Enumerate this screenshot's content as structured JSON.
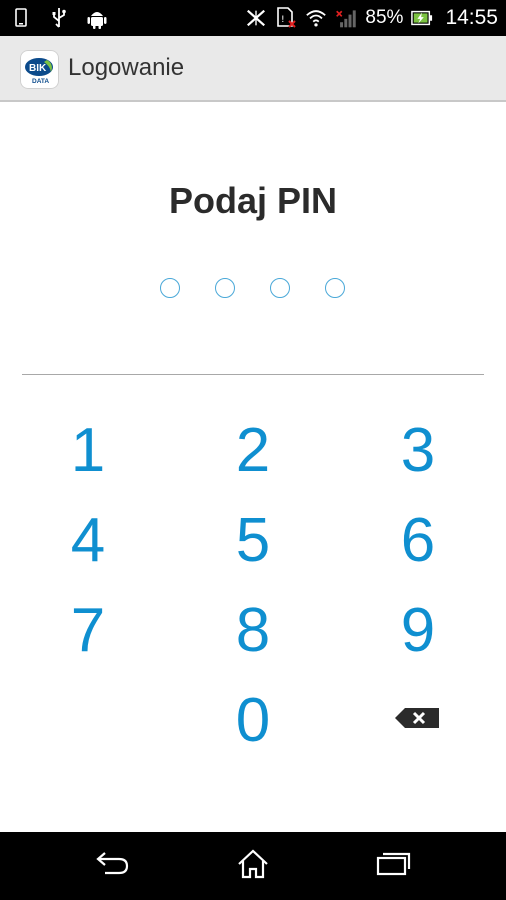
{
  "status_bar": {
    "battery_percent": "85%",
    "time": "14:55",
    "icons": [
      "phone-outline-icon",
      "usb-icon",
      "android-icon",
      "nfc-icon",
      "sim-error-icon",
      "wifi-icon",
      "signal-icon",
      "battery-charging-icon"
    ]
  },
  "action_bar": {
    "logo_text_top": "BIK",
    "logo_text_bottom": "DATA",
    "title": "Logowanie"
  },
  "pin": {
    "prompt": "Podaj PIN",
    "length": 4,
    "entered": 0
  },
  "keypad": {
    "keys": [
      "1",
      "2",
      "3",
      "4",
      "5",
      "6",
      "7",
      "8",
      "9",
      "0"
    ],
    "backspace_icon": "backspace-icon"
  },
  "nav_bar": {
    "icons": [
      "back-icon",
      "home-icon",
      "recents-icon"
    ]
  },
  "colors": {
    "accent": "#0f8fd0",
    "dot_border": "#4aa8d8",
    "action_bar": "#e9e9e9",
    "title_text": "#2b2b2b"
  }
}
